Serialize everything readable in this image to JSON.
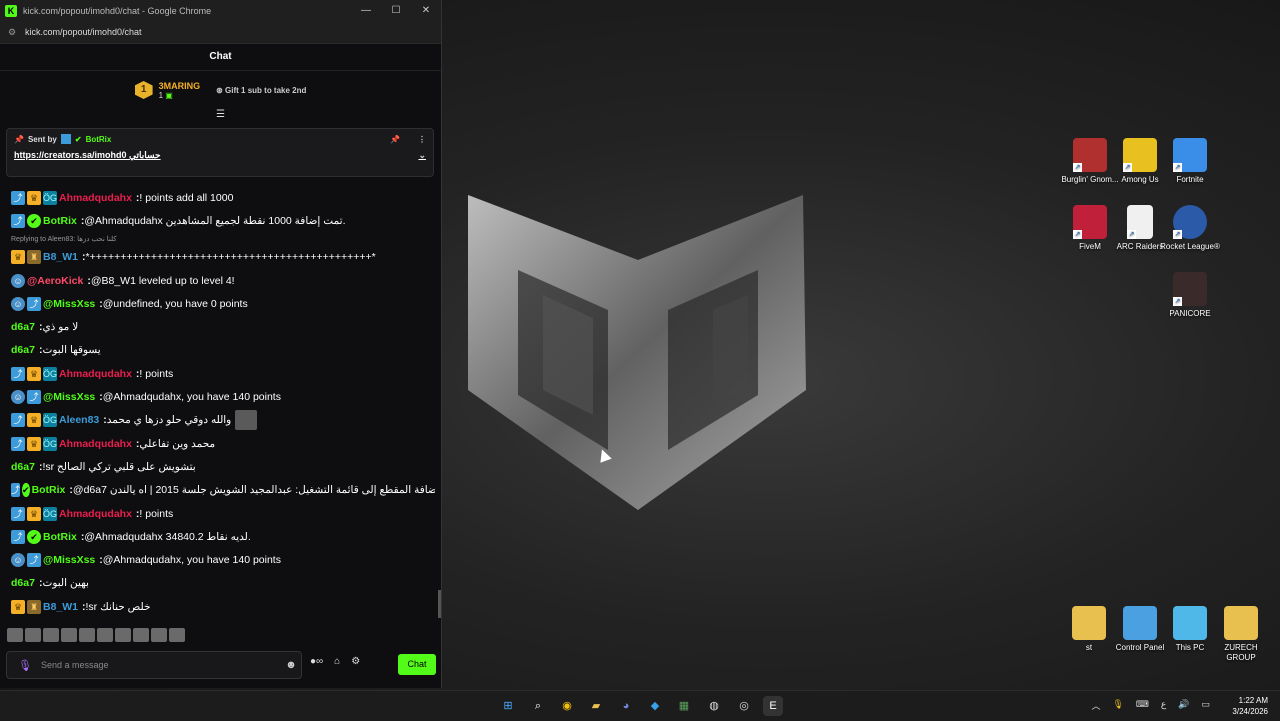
{
  "window": {
    "title": "kick.com/popout/imohd0/chat - Google Chrome",
    "url": "kick.com/popout/imohd0/chat"
  },
  "chat": {
    "header": "Chat",
    "leaderboard": {
      "rank": "1",
      "name": "3MARING",
      "count": "1",
      "gift_text": "Gift 1 sub to take 2nd"
    },
    "pinned": {
      "sent_by": "Sent by",
      "sender": "BotRix",
      "link": "https://creators.sa/imohd0 حساباتي"
    },
    "messages": [
      {
        "badges": [
          "mod",
          "crown",
          "og"
        ],
        "user": "Ahmadqudahx",
        "color": "#e91e4f",
        "text": "! points add all 1000"
      },
      {
        "badges": [
          "mod",
          "ver"
        ],
        "user": "BotRix",
        "color": "#53fc18",
        "text": "@Ahmadqudahx تمت إضافة 1000 نقطة لجميع المشاهدين."
      },
      {
        "reply": "Replying to Aleen83: كلنا نحب دزها"
      },
      {
        "badges": [
          "crown",
          "sub"
        ],
        "user": "B8_W1",
        "color": "#3d9bd9",
        "text": "*++++++++++++++++++++++++++++++++++++++++++++++*"
      },
      {
        "badges": [
          "bot"
        ],
        "user": "@AeroKick",
        "color": "#ff4a6a",
        "text": "@B8_W1 leveled up to level 4!"
      },
      {
        "badges": [
          "bot",
          "mod"
        ],
        "user": "@MissXss",
        "color": "#53fc18",
        "text": "@undefined, you have 0 points"
      },
      {
        "badges": [],
        "user": "d6a7",
        "color": "#53fc18",
        "text": "لا مو ذي"
      },
      {
        "badges": [],
        "user": "d6a7",
        "color": "#53fc18",
        "text": "يسوقها البوت"
      },
      {
        "badges": [
          "mod",
          "crown",
          "og"
        ],
        "user": "Ahmadqudahx",
        "color": "#e91e4f",
        "text": "! points"
      },
      {
        "badges": [
          "bot",
          "mod"
        ],
        "user": "@MissXss",
        "color": "#53fc18",
        "text": "@Ahmadqudahx, you have 140 points"
      },
      {
        "badges": [
          "mod",
          "crown",
          "og"
        ],
        "user": "Aleen83",
        "color": "#3d9bd9",
        "text": "والله دوقي حلو دزها ي محمد",
        "emote": true
      },
      {
        "badges": [
          "mod",
          "crown",
          "og"
        ],
        "user": "Ahmadqudahx",
        "color": "#e91e4f",
        "text": "محمد وين تفاعلي"
      },
      {
        "badges": [],
        "user": "d6a7",
        "color": "#53fc18",
        "text": "!sr بتشويش على قلبي تركي الصالح"
      },
      {
        "badges": [
          "mod",
          "ver"
        ],
        "user": "BotRix",
        "color": "#53fc18",
        "text": "@d6a7 تمت إضافة المقطع إلى قائمة التشغيل: عبدالمجيد الشويش جلسة 2015 | اه يالندن."
      },
      {
        "badges": [
          "mod",
          "crown",
          "og"
        ],
        "user": "Ahmadqudahx",
        "color": "#e91e4f",
        "text": "! points"
      },
      {
        "badges": [
          "mod",
          "ver"
        ],
        "user": "BotRix",
        "color": "#53fc18",
        "text": "@Ahmadqudahx لديه نقاط 34840.2."
      },
      {
        "badges": [
          "bot",
          "mod"
        ],
        "user": "@MissXss",
        "color": "#53fc18",
        "text": "@Ahmadqudahx, you have 140 points"
      },
      {
        "badges": [],
        "user": "d6a7",
        "color": "#53fc18",
        "text": "بهين البوت"
      },
      {
        "badges": [
          "crown",
          "sub"
        ],
        "user": "B8_W1",
        "color": "#3d9bd9",
        "text": "!sr خلص حنانك"
      }
    ],
    "composer": {
      "placeholder": "Send a message",
      "send_label": "Chat"
    }
  },
  "desktop": {
    "icons": [
      {
        "label": "Burglin' Gnom...",
        "color": "#b03030"
      },
      {
        "label": "Among Us",
        "color": "#e8c020"
      },
      {
        "label": "Fortnite",
        "color": "#3a8ee8"
      },
      {
        "label": "FiveM",
        "color": "#c0203a"
      },
      {
        "label": "ARC Raiders",
        "color": "#f0f0f0"
      },
      {
        "label": "Rocket League®",
        "color": "#2a5aa8"
      },
      {
        "label": "PANICORE",
        "color": "#3a2a2a"
      },
      {
        "label": "st",
        "color": "#e8c050"
      },
      {
        "label": "Control Panel",
        "color": "#4aa0e0"
      },
      {
        "label": "This PC",
        "color": "#50b8e8"
      },
      {
        "label": "ZURECH GROUP",
        "color": "#e8c050"
      }
    ]
  },
  "taskbar": {
    "lang": "ع",
    "time": "1:22 AM",
    "date": "3/24/2026"
  }
}
